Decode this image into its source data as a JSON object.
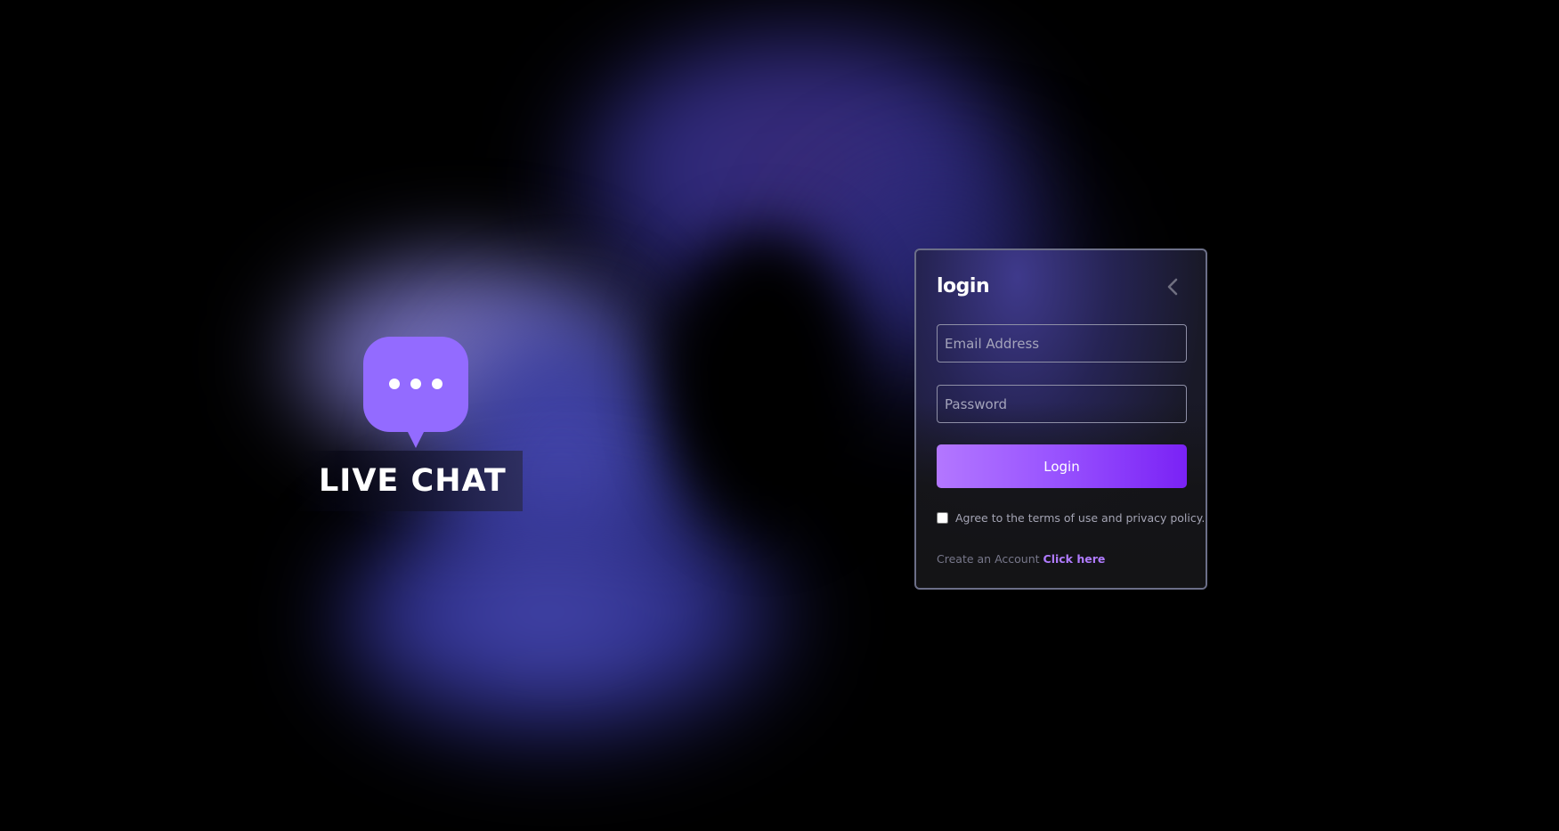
{
  "logo": {
    "icon": "chat-bubble-icon",
    "title": "LIVE CHAT",
    "color": "#936bff"
  },
  "login_card": {
    "title": "login",
    "back_icon": "chevron-left-icon",
    "email": {
      "placeholder": "Email Address",
      "value": ""
    },
    "password": {
      "placeholder": "Password",
      "value": ""
    },
    "login_button_label": "Login",
    "terms": {
      "checked": false,
      "label": "Agree to the terms of use and privacy policy."
    },
    "create_account": {
      "text": "Create an Account",
      "link_label": "Click here"
    },
    "accent_color": "#9a55ff"
  }
}
